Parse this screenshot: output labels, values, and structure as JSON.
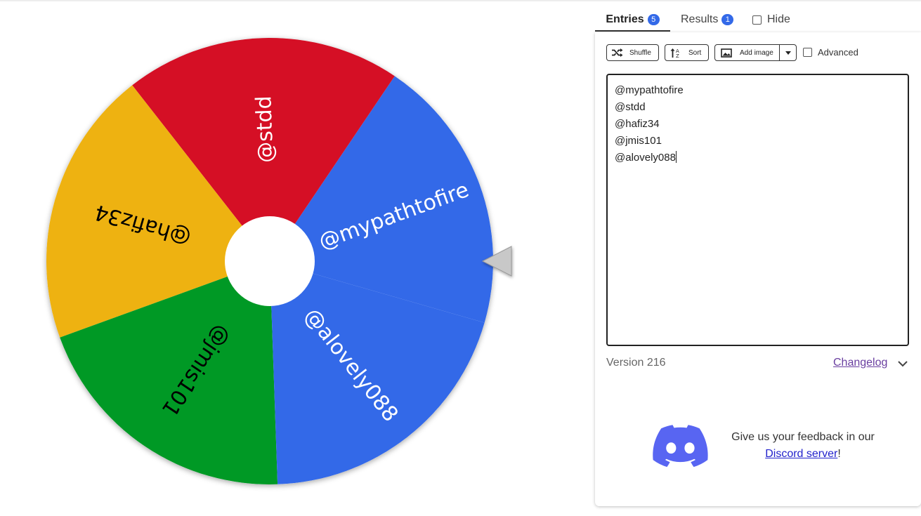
{
  "wheel": {
    "center_color": "#ffffff",
    "pointer_color": "#c8c8c8",
    "segments": [
      {
        "label": "@mypathtofire",
        "color": "#3369e8",
        "text_color": "#ffffff"
      },
      {
        "label": "@stdd",
        "color": "#d50f25",
        "text_color": "#ffffff"
      },
      {
        "label": "@hafiz34",
        "color": "#eeb211",
        "text_color": "#000000"
      },
      {
        "label": "@jmis101",
        "color": "#009925",
        "text_color": "#000000"
      },
      {
        "label": "@alovely088",
        "color": "#3369e8",
        "text_color": "#ffffff"
      }
    ]
  },
  "tabs": {
    "entries_label": "Entries",
    "entries_count": "5",
    "results_label": "Results",
    "results_count": "1",
    "hide_label": "Hide"
  },
  "toolbar": {
    "shuffle_label": "Shuffle",
    "sort_label": "Sort",
    "add_image_label": "Add image",
    "advanced_label": "Advanced"
  },
  "entries": [
    "@mypathtofire",
    "@stdd",
    "@hafiz34",
    "@jmis101",
    "@alovely088"
  ],
  "footer": {
    "version_text": "Version 216",
    "changelog_label": "Changelog",
    "feedback_text": "Give us your feedback in our",
    "discord_link_text": "Discord server",
    "feedback_suffix": "!"
  },
  "colors": {
    "accent": "#3369e8",
    "discord": "#5865f2",
    "changelog_link": "#6a3fa0"
  }
}
